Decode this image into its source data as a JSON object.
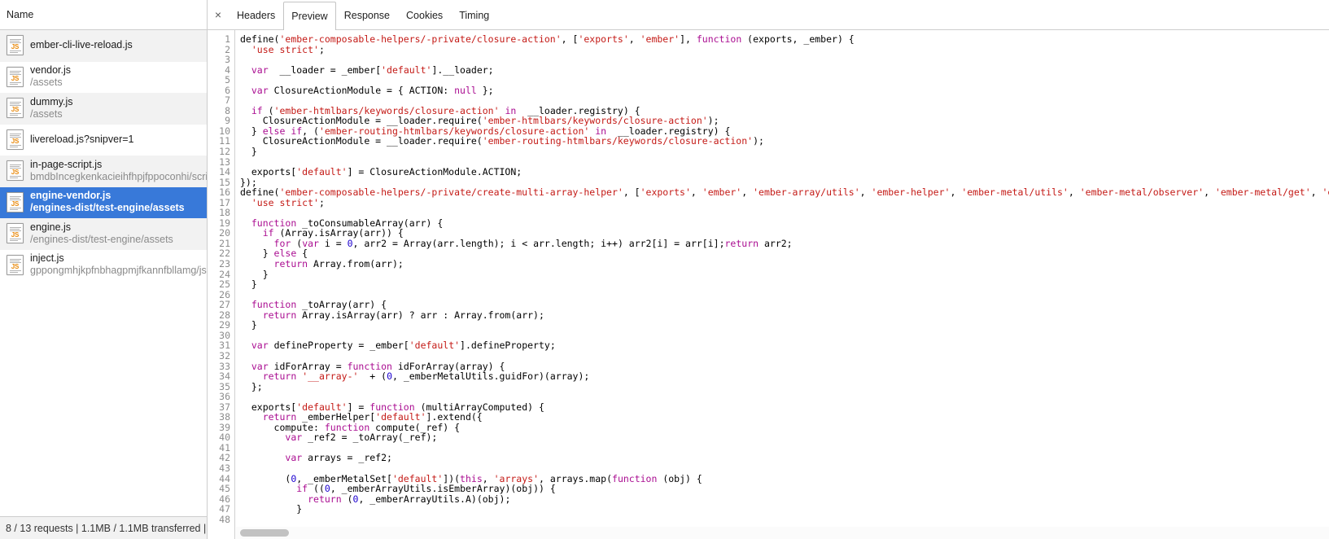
{
  "colors": {
    "selection_blue": "#3879d9",
    "keyword_purple": "#aa0d91",
    "string_red": "#c41a16",
    "number_blue": "#1c00cf",
    "gutter_gray": "#8c8c8c",
    "icon_orange": "#e8890c"
  },
  "left_panel": {
    "header": {
      "name_label": "Name"
    },
    "icon_label": "JS",
    "requests": [
      {
        "name": "ember-cli-live-reload.js",
        "sub": ""
      },
      {
        "name": "vendor.js",
        "sub": "/assets"
      },
      {
        "name": "dummy.js",
        "sub": "/assets"
      },
      {
        "name": "livereload.js?snipver=1",
        "sub": ""
      },
      {
        "name": "in-page-script.js",
        "sub": "bmdbIncegkenkacieihfhpjfppoconhi/scripts"
      },
      {
        "name": "engine-vendor.js",
        "sub": "/engines-dist/test-engine/assets"
      },
      {
        "name": "engine.js",
        "sub": "/engines-dist/test-engine/assets"
      },
      {
        "name": "inject.js",
        "sub": "gppongmhjkpfnbhagpmjfkannfbllamg/js"
      }
    ],
    "selected_index": 5,
    "status_bar": "8 / 13 requests | 1.1MB / 1.1MB transferred | …"
  },
  "right_panel": {
    "close_icon_glyph": "×",
    "tabs": [
      {
        "label": "Headers",
        "active": false
      },
      {
        "label": "Preview",
        "active": true
      },
      {
        "label": "Response",
        "active": false
      },
      {
        "label": "Cookies",
        "active": false
      },
      {
        "label": "Timing",
        "active": false
      }
    ],
    "code": {
      "first_line_number": 1,
      "last_line_number": 48,
      "lines": [
        [
          [
            "",
            "define("
          ],
          [
            "str",
            "'ember-composable-helpers/-private/closure-action'"
          ],
          [
            "",
            ", ["
          ],
          [
            "str",
            "'exports'"
          ],
          [
            "",
            ", "
          ],
          [
            "str",
            "'ember'"
          ],
          [
            "",
            "], "
          ],
          [
            "kw",
            "function"
          ],
          [
            "",
            " (exports, _ember) {"
          ]
        ],
        [
          [
            "",
            "  "
          ],
          [
            "str",
            "'use strict'"
          ],
          [
            "",
            ";"
          ]
        ],
        [
          [
            "",
            ""
          ]
        ],
        [
          [
            "",
            "  "
          ],
          [
            "kw",
            "var"
          ],
          [
            "",
            "  __loader = _ember["
          ],
          [
            "str",
            "'default'"
          ],
          [
            "",
            "].__loader;"
          ]
        ],
        [
          [
            "",
            ""
          ]
        ],
        [
          [
            "",
            "  "
          ],
          [
            "kw",
            "var"
          ],
          [
            "",
            " ClosureActionModule = { ACTION: "
          ],
          [
            "kw",
            "null"
          ],
          [
            "",
            " };"
          ]
        ],
        [
          [
            "",
            ""
          ]
        ],
        [
          [
            "",
            "  "
          ],
          [
            "kw",
            "if"
          ],
          [
            "",
            " ("
          ],
          [
            "str",
            "'ember-htmlbars/keywords/closure-action'"
          ],
          [
            "kw",
            " in"
          ],
          [
            "",
            "  __loader.registry) {"
          ]
        ],
        [
          [
            "",
            "    ClosureActionModule = __loader.require("
          ],
          [
            "str",
            "'ember-htmlbars/keywords/closure-action'"
          ],
          [
            "",
            "); "
          ]
        ],
        [
          [
            "",
            "  } "
          ],
          [
            "kw",
            "else if"
          ],
          [
            "",
            ", ("
          ],
          [
            "str",
            "'ember-routing-htmlbars/keywords/closure-action'"
          ],
          [
            "kw",
            " in"
          ],
          [
            "",
            "  __loader.registry) {"
          ]
        ],
        [
          [
            "",
            "    ClosureActionModule = __loader.require("
          ],
          [
            "str",
            "'ember-routing-htmlbars/keywords/closure-action'"
          ],
          [
            "",
            "); "
          ]
        ],
        [
          [
            "",
            "  }"
          ]
        ],
        [
          [
            "",
            ""
          ]
        ],
        [
          [
            "",
            "  exports["
          ],
          [
            "str",
            "'default'"
          ],
          [
            "",
            "] = ClosureActionModule.ACTION;"
          ]
        ],
        [
          [
            "",
            "});"
          ]
        ],
        [
          [
            "",
            "define("
          ],
          [
            "str",
            "'ember-composable-helpers/-private/create-multi-array-helper'"
          ],
          [
            "",
            ", ["
          ],
          [
            "str",
            "'exports'"
          ],
          [
            "",
            ", "
          ],
          [
            "str",
            "'ember'"
          ],
          [
            "",
            ", "
          ],
          [
            "str",
            "'ember-array/utils'"
          ],
          [
            "",
            ", "
          ],
          [
            "str",
            "'ember-helper'"
          ],
          [
            "",
            ", "
          ],
          [
            "str",
            "'ember-metal/utils'"
          ],
          [
            "",
            ", "
          ],
          [
            "str",
            "'ember-metal/observer'"
          ],
          [
            "",
            ", "
          ],
          [
            "str",
            "'ember-metal/get'"
          ],
          [
            "",
            ", "
          ],
          [
            "str",
            "'ember"
          ]
        ],
        [
          [
            "",
            "  "
          ],
          [
            "str",
            "'use strict'"
          ],
          [
            "",
            ";"
          ]
        ],
        [
          [
            "",
            ""
          ]
        ],
        [
          [
            "",
            "  "
          ],
          [
            "kw",
            "function"
          ],
          [
            "",
            " _toConsumableArray(arr) {"
          ]
        ],
        [
          [
            "",
            "    "
          ],
          [
            "kw",
            "if"
          ],
          [
            "",
            " (Array.isArray(arr)) {"
          ]
        ],
        [
          [
            "",
            "      "
          ],
          [
            "kw",
            "for"
          ],
          [
            "",
            " ("
          ],
          [
            "kw",
            "var"
          ],
          [
            "",
            " i = "
          ],
          [
            "num",
            "0"
          ],
          [
            "",
            ", arr2 = Array(arr.length); i < arr.length; i++) arr2[i] = arr[i];"
          ],
          [
            "kw",
            "return"
          ],
          [
            "",
            " arr2;"
          ]
        ],
        [
          [
            "",
            "    } "
          ],
          [
            "kw",
            "else"
          ],
          [
            "",
            " {"
          ]
        ],
        [
          [
            "",
            "      "
          ],
          [
            "kw",
            "return"
          ],
          [
            "",
            " Array.from(arr);"
          ]
        ],
        [
          [
            "",
            "    }"
          ]
        ],
        [
          [
            "",
            "  }"
          ]
        ],
        [
          [
            "",
            ""
          ]
        ],
        [
          [
            "",
            "  "
          ],
          [
            "kw",
            "function"
          ],
          [
            "",
            " _toArray(arr) {"
          ]
        ],
        [
          [
            "",
            "    "
          ],
          [
            "kw",
            "return"
          ],
          [
            "",
            " Array.isArray(arr) ? arr : Array.from(arr);"
          ]
        ],
        [
          [
            "",
            "  }"
          ]
        ],
        [
          [
            "",
            ""
          ]
        ],
        [
          [
            "",
            "  "
          ],
          [
            "kw",
            "var"
          ],
          [
            "",
            " defineProperty = _ember["
          ],
          [
            "str",
            "'default'"
          ],
          [
            "",
            "].defineProperty;"
          ]
        ],
        [
          [
            "",
            ""
          ]
        ],
        [
          [
            "",
            "  "
          ],
          [
            "kw",
            "var"
          ],
          [
            "",
            " idForArray = "
          ],
          [
            "kw",
            "function"
          ],
          [
            "",
            " idForArray(array) {"
          ]
        ],
        [
          [
            "",
            "    "
          ],
          [
            "kw",
            "return"
          ],
          [
            "",
            " "
          ],
          [
            "str",
            "'__array-'"
          ],
          [
            "",
            "  + ("
          ],
          [
            "num",
            "0"
          ],
          [
            "",
            ", _emberMetalUtils.guidFor)(array);"
          ]
        ],
        [
          [
            "",
            "  };"
          ]
        ],
        [
          [
            "",
            ""
          ]
        ],
        [
          [
            "",
            "  exports["
          ],
          [
            "str",
            "'default'"
          ],
          [
            "",
            "] = "
          ],
          [
            "kw",
            "function"
          ],
          [
            "",
            " (multiArrayComputed) {"
          ]
        ],
        [
          [
            "",
            "    "
          ],
          [
            "kw",
            "return"
          ],
          [
            "",
            " _emberHelper["
          ],
          [
            "str",
            "'default'"
          ],
          [
            "",
            "].extend({"
          ]
        ],
        [
          [
            "",
            "      compute: "
          ],
          [
            "kw",
            "function"
          ],
          [
            "",
            " compute(_ref) {"
          ]
        ],
        [
          [
            "",
            "        "
          ],
          [
            "kw",
            "var"
          ],
          [
            "",
            " _ref2 = _toArray(_ref);"
          ]
        ],
        [
          [
            "",
            ""
          ]
        ],
        [
          [
            "",
            "        "
          ],
          [
            "kw",
            "var"
          ],
          [
            "",
            " arrays = _ref2;"
          ]
        ],
        [
          [
            "",
            ""
          ]
        ],
        [
          [
            "",
            "        ("
          ],
          [
            "num",
            "0"
          ],
          [
            "",
            ", _emberMetalSet["
          ],
          [
            "str",
            "'default'"
          ],
          [
            "",
            "])("
          ],
          [
            "kw",
            "this"
          ],
          [
            "",
            ", "
          ],
          [
            "str",
            "'arrays'"
          ],
          [
            "",
            ", arrays.map("
          ],
          [
            "kw",
            "function"
          ],
          [
            "",
            " (obj) {"
          ]
        ],
        [
          [
            "",
            "          "
          ],
          [
            "kw",
            "if"
          ],
          [
            "",
            " (("
          ],
          [
            "num",
            "0"
          ],
          [
            "",
            ", _emberArrayUtils.isEmberArray)(obj)) {"
          ]
        ],
        [
          [
            "",
            "            "
          ],
          [
            "kw",
            "return"
          ],
          [
            "",
            " ("
          ],
          [
            "num",
            "0"
          ],
          [
            "",
            ", _emberArrayUtils.A)(obj);"
          ]
        ],
        [
          [
            "",
            "          }"
          ]
        ],
        [
          [
            "",
            ""
          ]
        ]
      ]
    }
  }
}
